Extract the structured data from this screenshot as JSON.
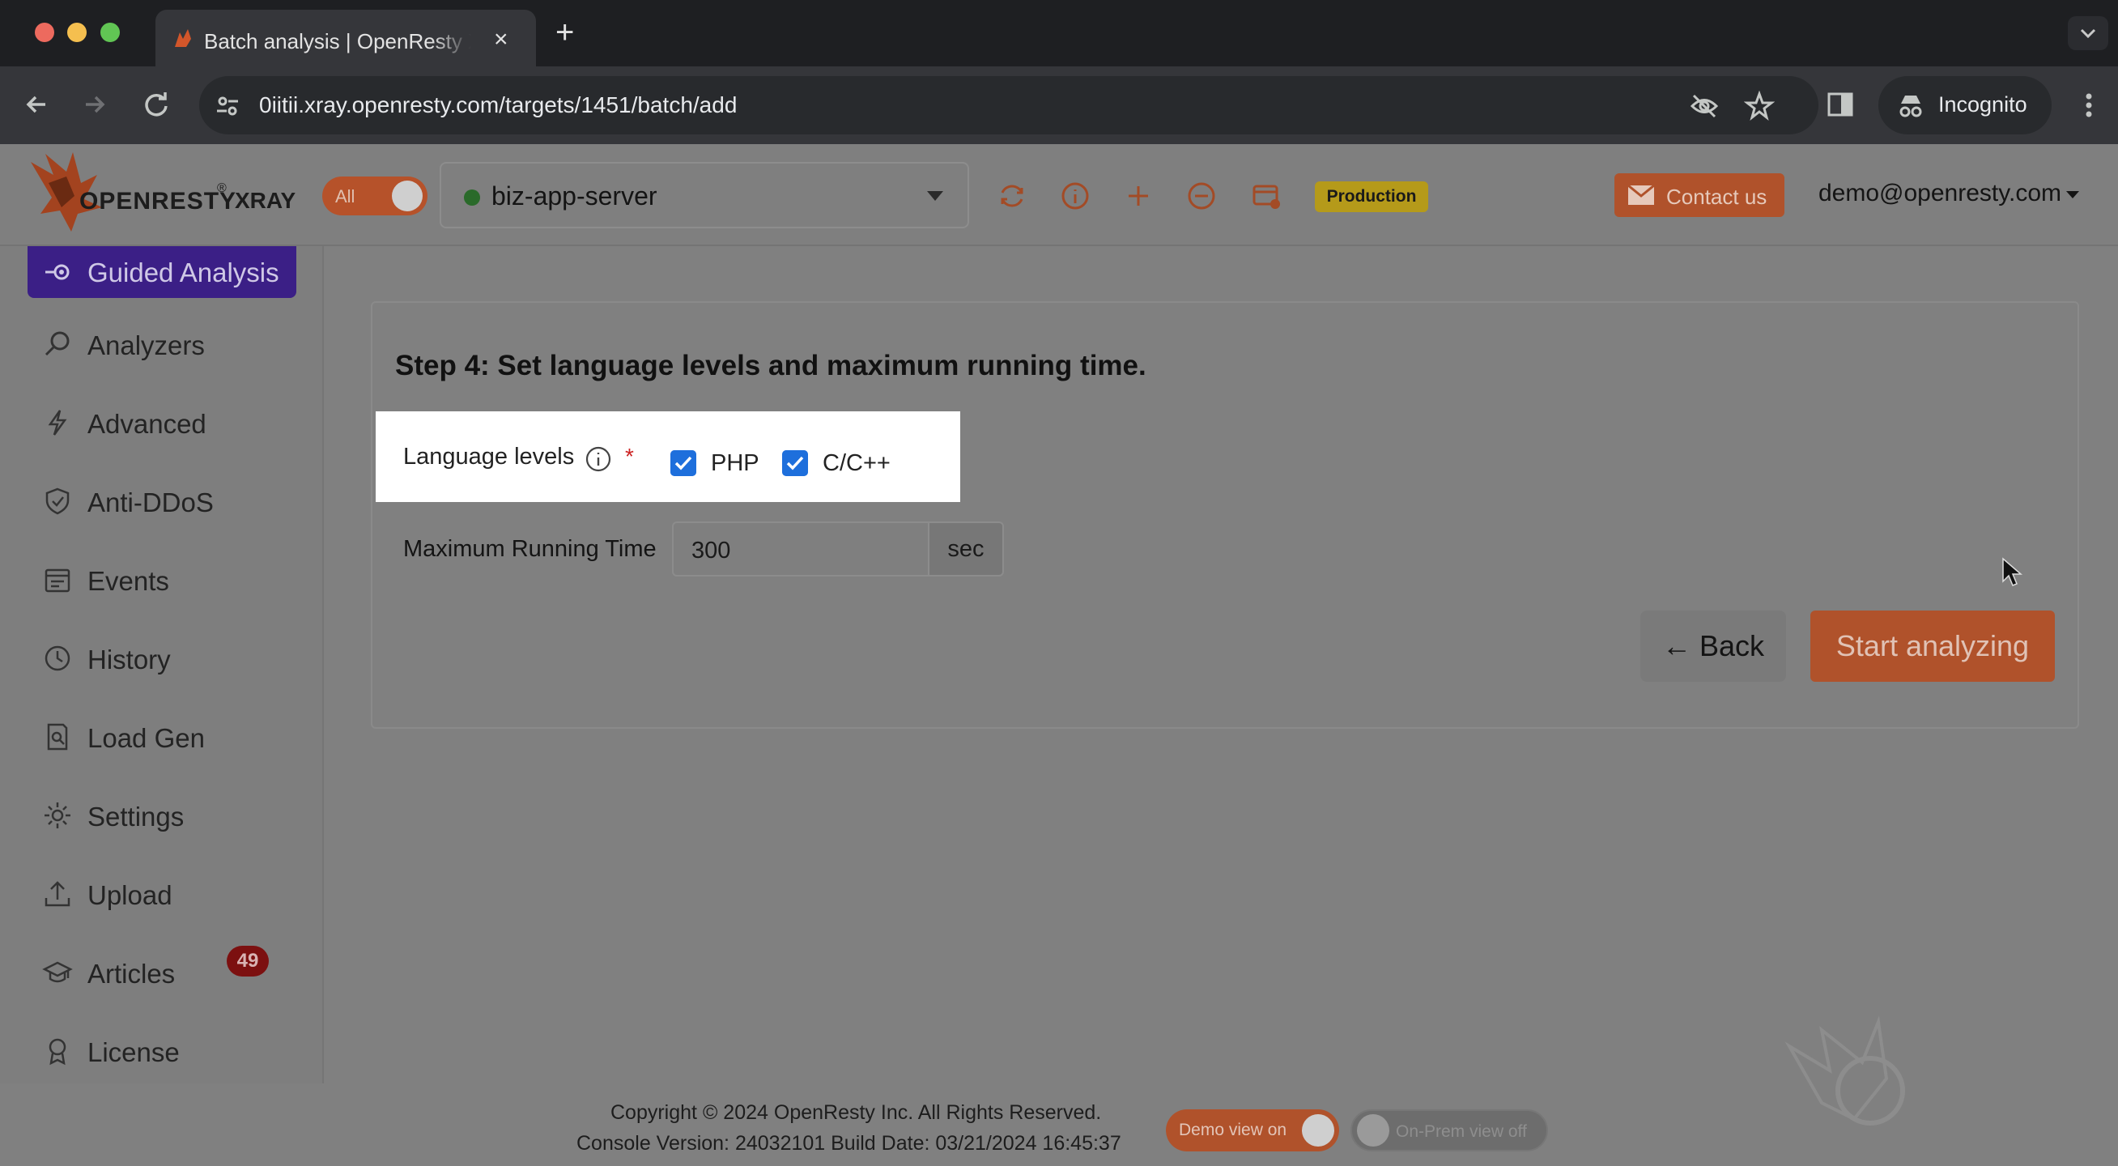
{
  "browser": {
    "tab_title": "Batch analysis | OpenResty XRay",
    "new_tab_symbol": "+",
    "close_symbol": "×",
    "url": "0iitii.xray.openresty.com/targets/1451/batch/add",
    "incognito_label": "Incognito"
  },
  "header": {
    "logo_brand": "OPENRESTY",
    "logo_reg": "®",
    "logo_product": "XRAY",
    "all_toggle_label": "All",
    "target_name": "biz-app-server",
    "environment_badge": "Production",
    "contact_label": "Contact us",
    "user_email": "demo@openresty.com",
    "colors": {
      "accent": "#b0522b",
      "badge": "#b59a1a",
      "status_online": "#2a6a2a"
    }
  },
  "sidebar": {
    "active_item": {
      "label": "Guided Analysis",
      "icon": "guided-analysis-icon"
    },
    "items": [
      {
        "label": "Analyzers",
        "icon": "search-icon"
      },
      {
        "label": "Advanced",
        "icon": "lightning-icon"
      },
      {
        "label": "Anti-DDoS",
        "icon": "shield-icon"
      },
      {
        "label": "Events",
        "icon": "calendar-icon"
      },
      {
        "label": "History",
        "icon": "clock-icon"
      },
      {
        "label": "Load Gen",
        "icon": "document-search-icon"
      },
      {
        "label": "Settings",
        "icon": "gear-icon"
      },
      {
        "label": "Upload",
        "icon": "upload-icon"
      },
      {
        "label": "Articles",
        "icon": "graduation-cap-icon",
        "badge": "49"
      },
      {
        "label": "License",
        "icon": "award-icon"
      }
    ]
  },
  "main": {
    "step_title": "Step 4: Set language levels and maximum running time.",
    "language_levels": {
      "label": "Language levels",
      "required_mark": "*",
      "options": [
        {
          "label": "PHP",
          "checked": true
        },
        {
          "label": "C/C++",
          "checked": true
        }
      ]
    },
    "max_running_time": {
      "label": "Maximum Running Time",
      "value": "300",
      "unit": "sec"
    },
    "back_label": "← Back",
    "start_label": "Start analyzing"
  },
  "footer": {
    "copyright": "Copyright © 2024 OpenResty Inc. All Rights Reserved.",
    "console_version": "Console Version: 24032101 Build Date: 03/21/2024 16:45:37",
    "demo_view_label": "Demo view on",
    "onprem_view_label": "On-Prem view off"
  }
}
